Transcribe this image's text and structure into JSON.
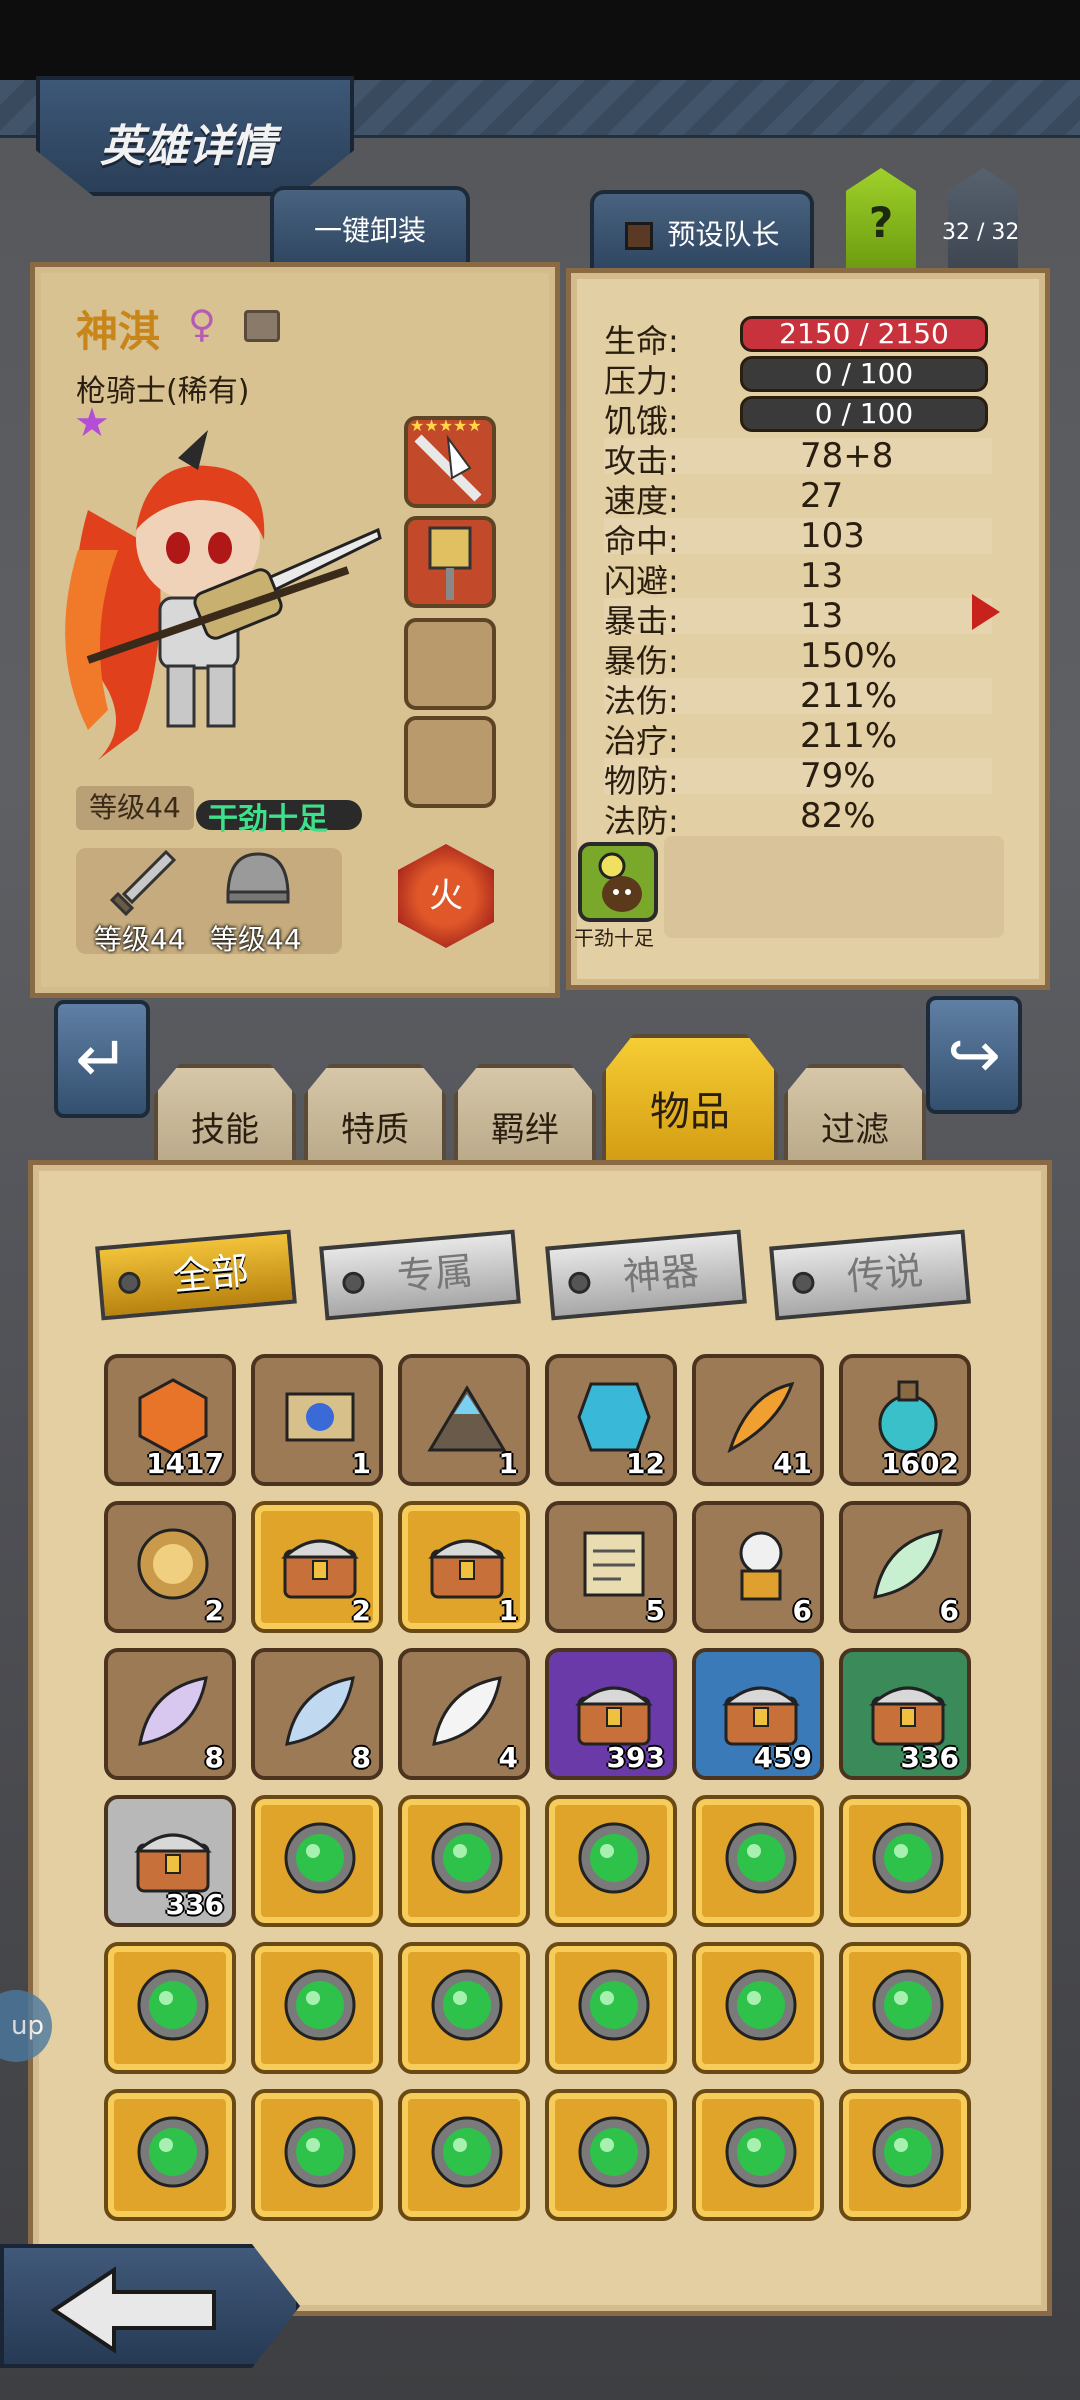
{
  "header": {
    "title": "英雄详情"
  },
  "top_buttons": {
    "unequip_all": "一键卸装",
    "preset_leader": "预设队长",
    "help": "?",
    "hero_count": "32 / 32"
  },
  "hero": {
    "name": "神淇",
    "class": "枪骑士(稀有)",
    "level": "等级44",
    "status": "干劲十足",
    "element": "火",
    "weapon_level": "等级44",
    "armor_level": "等级44",
    "slot_stars": "★★★★★"
  },
  "stats": {
    "hp": {
      "label": "生命:",
      "value": "2150 / 2150"
    },
    "stress": {
      "label": "压力:",
      "value": "0 / 100"
    },
    "hunger": {
      "label": "饥饿:",
      "value": "0 / 100"
    },
    "rows": [
      {
        "label": "攻击:",
        "value": "78+8"
      },
      {
        "label": "速度:",
        "value": "27"
      },
      {
        "label": "命中:",
        "value": "103"
      },
      {
        "label": "闪避:",
        "value": "13"
      },
      {
        "label": "暴击:",
        "value": "13"
      },
      {
        "label": "暴伤:",
        "value": "150%"
      },
      {
        "label": "法伤:",
        "value": "211%"
      },
      {
        "label": "治疗:",
        "value": "211%"
      },
      {
        "label": "物防:",
        "value": "79%"
      },
      {
        "label": "法防:",
        "value": "82%"
      }
    ],
    "trait_label": "干劲十足"
  },
  "tabs": [
    "技能",
    "特质",
    "羁绊",
    "物品",
    "过滤"
  ],
  "active_tab": "物品",
  "filters": [
    "全部",
    "专属",
    "神器",
    "传说"
  ],
  "active_filter": "全部",
  "items": [
    {
      "icon": "orange-rune-icon",
      "count": "1417",
      "rarity": "brown"
    },
    {
      "icon": "magic-scroll-icon",
      "count": "1",
      "rarity": "brown"
    },
    {
      "icon": "crystal-pile-icon",
      "count": "1",
      "rarity": "brown"
    },
    {
      "icon": "blue-stone-icon",
      "count": "12",
      "rarity": "brown"
    },
    {
      "icon": "fire-feather-icon",
      "count": "41",
      "rarity": "brown"
    },
    {
      "icon": "potion-icon",
      "count": "1602",
      "rarity": "brown"
    },
    {
      "icon": "golden-orb-icon",
      "count": "2",
      "rarity": "brown"
    },
    {
      "icon": "treasure-chest-icon",
      "count": "2",
      "rarity": "gold"
    },
    {
      "icon": "treasure-chest-icon",
      "count": "1",
      "rarity": "gold"
    },
    {
      "icon": "paper-scroll-icon",
      "count": "5",
      "rarity": "brown"
    },
    {
      "icon": "skull-figure-icon",
      "count": "6",
      "rarity": "brown"
    },
    {
      "icon": "green-leaf-icon",
      "count": "6",
      "rarity": "brown"
    },
    {
      "icon": "purple-feather-icon",
      "count": "8",
      "rarity": "brown"
    },
    {
      "icon": "blue-feather-icon",
      "count": "8",
      "rarity": "brown"
    },
    {
      "icon": "white-feather-icon",
      "count": "4",
      "rarity": "brown"
    },
    {
      "icon": "treasure-chest-icon",
      "count": "393",
      "rarity": "purple"
    },
    {
      "icon": "treasure-chest-icon",
      "count": "459",
      "rarity": "blue"
    },
    {
      "icon": "treasure-chest-icon",
      "count": "336",
      "rarity": "green"
    },
    {
      "icon": "treasure-chest-icon",
      "count": "336",
      "rarity": "grey"
    },
    {
      "icon": "green-gem-icon",
      "count": "",
      "rarity": "gold"
    },
    {
      "icon": "green-gem-icon",
      "count": "",
      "rarity": "gold"
    },
    {
      "icon": "green-gem-icon",
      "count": "",
      "rarity": "gold"
    },
    {
      "icon": "green-gem-icon",
      "count": "",
      "rarity": "gold"
    },
    {
      "icon": "green-gem-icon",
      "count": "",
      "rarity": "gold"
    },
    {
      "icon": "green-gem-icon",
      "count": "",
      "rarity": "gold"
    },
    {
      "icon": "green-gem-icon",
      "count": "",
      "rarity": "gold"
    },
    {
      "icon": "green-gem-icon",
      "count": "",
      "rarity": "gold"
    },
    {
      "icon": "green-gem-icon",
      "count": "",
      "rarity": "gold"
    },
    {
      "icon": "green-gem-icon",
      "count": "",
      "rarity": "gold"
    },
    {
      "icon": "green-gem-icon",
      "count": "",
      "rarity": "gold"
    },
    {
      "icon": "green-gem-icon",
      "count": "",
      "rarity": "gold"
    },
    {
      "icon": "green-gem-icon",
      "count": "",
      "rarity": "gold"
    },
    {
      "icon": "green-gem-icon",
      "count": "",
      "rarity": "gold"
    },
    {
      "icon": "green-gem-icon",
      "count": "",
      "rarity": "gold"
    },
    {
      "icon": "green-gem-icon",
      "count": "",
      "rarity": "gold"
    },
    {
      "icon": "green-gem-icon",
      "count": "",
      "rarity": "gold"
    }
  ],
  "colors": {
    "parchment": "#e3cfa4",
    "frame": "#8a6a44",
    "accent_gold": "#f6cd34",
    "hp_bar": "#c8323c",
    "status_green": "#3ee08a"
  }
}
